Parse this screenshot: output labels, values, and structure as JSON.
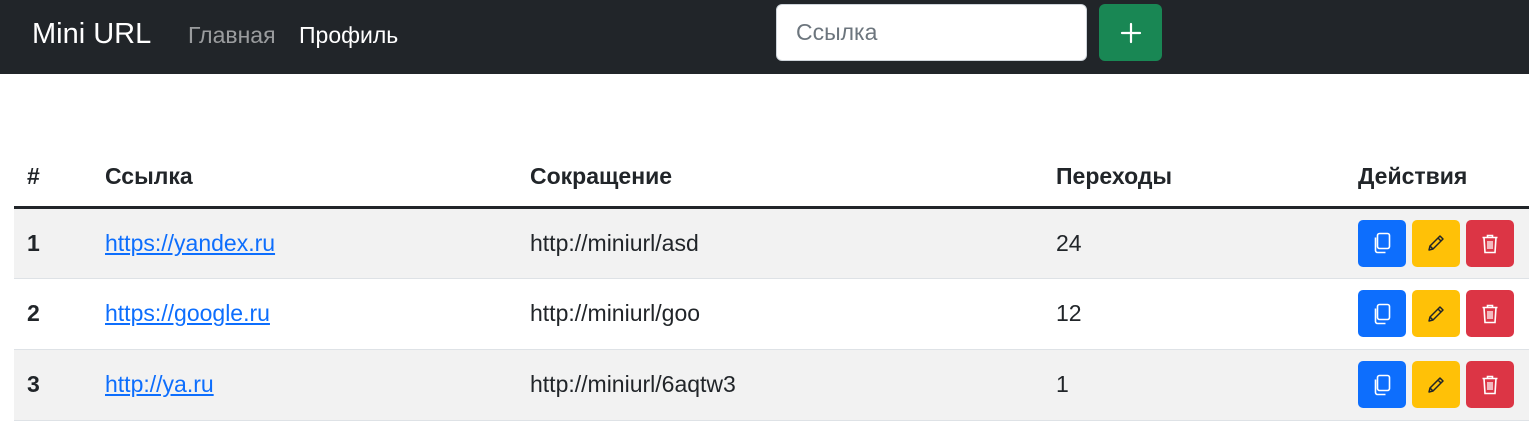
{
  "navbar": {
    "brand": "Mini URL",
    "links": [
      {
        "label": "Главная"
      },
      {
        "label": "Профиль"
      }
    ],
    "search": {
      "placeholder": "Ссылка",
      "value": ""
    },
    "add_icon": "plus-icon"
  },
  "table": {
    "headers": [
      "#",
      "Ссылка",
      "Сокращение",
      "Переходы",
      "Действия"
    ],
    "rows": [
      {
        "num": "1",
        "url": "https://yandex.ru",
        "short": "http://miniurl/asd",
        "clicks": "24"
      },
      {
        "num": "2",
        "url": "https://google.ru",
        "short": "http://miniurl/goo",
        "clicks": "12"
      },
      {
        "num": "3",
        "url": "http://ya.ru",
        "short": "http://miniurl/6aqtw3",
        "clicks": "1"
      }
    ],
    "action_icons": [
      "copy-icon",
      "pencil-icon",
      "trash-icon"
    ]
  },
  "colors": {
    "navbar": "#212529",
    "add_button": "#198754",
    "copy_button": "#0d6efd",
    "edit_button": "#ffc107",
    "delete_button": "#dc3545",
    "link": "#0d6efd"
  }
}
